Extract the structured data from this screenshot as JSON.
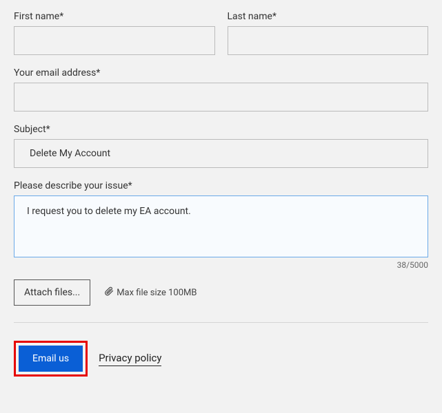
{
  "fields": {
    "first_name": {
      "label": "First name*",
      "value": ""
    },
    "last_name": {
      "label": "Last name*",
      "value": ""
    },
    "email": {
      "label": "Your email address*",
      "value": ""
    },
    "subject": {
      "label": "Subject*",
      "value": "Delete My Account"
    },
    "description": {
      "label": "Please describe your issue*",
      "value": "I request you to delete my EA account.",
      "char_count": "38/5000"
    }
  },
  "attach": {
    "button": "Attach files...",
    "hint": "Max file size 100MB"
  },
  "submit": {
    "button": "Email us",
    "privacy": "Privacy policy"
  }
}
